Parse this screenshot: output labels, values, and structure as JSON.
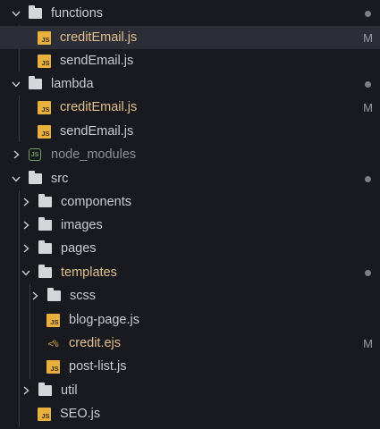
{
  "explorer": {
    "items": [
      {
        "label": "functions",
        "type": "folder",
        "expanded": true,
        "status": "dot"
      },
      {
        "label": "creditEmail.js",
        "type": "js",
        "modified": true,
        "status": "M"
      },
      {
        "label": "sendEmail.js",
        "type": "js",
        "modified": false,
        "status": ""
      },
      {
        "label": "lambda",
        "type": "folder",
        "expanded": true,
        "status": "dot"
      },
      {
        "label": "creditEmail.js",
        "type": "js",
        "modified": true,
        "status": "M"
      },
      {
        "label": "sendEmail.js",
        "type": "js",
        "modified": false,
        "status": ""
      },
      {
        "label": "node_modules",
        "type": "node-folder",
        "expanded": false,
        "status": ""
      },
      {
        "label": "src",
        "type": "folder",
        "expanded": true,
        "status": "dot"
      },
      {
        "label": "components",
        "type": "folder",
        "expanded": false,
        "status": ""
      },
      {
        "label": "images",
        "type": "folder",
        "expanded": false,
        "status": ""
      },
      {
        "label": "pages",
        "type": "folder",
        "expanded": false,
        "status": ""
      },
      {
        "label": "templates",
        "type": "folder",
        "expanded": true,
        "status": "dot"
      },
      {
        "label": "scss",
        "type": "folder",
        "expanded": false,
        "status": ""
      },
      {
        "label": "blog-page.js",
        "type": "js",
        "modified": false,
        "status": ""
      },
      {
        "label": "credit.ejs",
        "type": "ejs",
        "modified": true,
        "status": "M"
      },
      {
        "label": "post-list.js",
        "type": "js",
        "modified": false,
        "status": ""
      },
      {
        "label": "util",
        "type": "folder",
        "expanded": false,
        "status": ""
      },
      {
        "label": "SEO.js",
        "type": "js",
        "modified": false,
        "status": ""
      }
    ],
    "icons": {
      "js_text": "JS",
      "ejs_text": "<%",
      "node_text": "JS"
    },
    "colors": {
      "background": "#181a1f",
      "modified_text": "#e2c08d",
      "js_badge": "#e8b13d",
      "node_icon": "#6da05a"
    }
  }
}
